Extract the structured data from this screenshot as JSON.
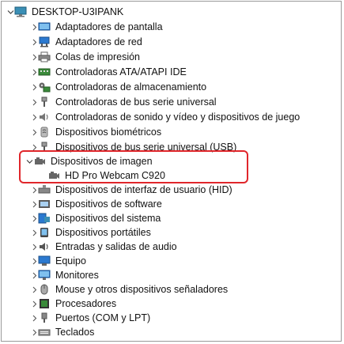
{
  "root": {
    "label": "DESKTOP-U3IPANK"
  },
  "categories": [
    {
      "label": "Adaptadores de pantalla",
      "icon": "display-adapter-icon"
    },
    {
      "label": "Adaptadores de red",
      "icon": "network-adapter-icon"
    },
    {
      "label": "Colas de impresión",
      "icon": "print-queue-icon"
    },
    {
      "label": "Controladoras ATA/ATAPI IDE",
      "icon": "ide-controller-icon"
    },
    {
      "label": "Controladoras de almacenamiento",
      "icon": "storage-controller-icon"
    },
    {
      "label": "Controladoras de bus serie universal",
      "icon": "usb-controller-icon"
    },
    {
      "label": "Controladoras de sonido y vídeo y dispositivos de juego",
      "icon": "sound-icon"
    },
    {
      "label": "Dispositivos biométricos",
      "icon": "biometric-icon"
    },
    {
      "label": "Dispositivos de bus serie universal (USB)",
      "icon": "usb-device-icon"
    },
    {
      "label": "Dispositivos de imagen",
      "icon": "camera-icon",
      "expanded": true,
      "children": [
        {
          "label": "HD Pro Webcam C920",
          "icon": "webcam-icon"
        }
      ]
    },
    {
      "label": "Dispositivos de interfaz de usuario (HID)",
      "icon": "hid-icon"
    },
    {
      "label": "Dispositivos de software",
      "icon": "software-device-icon"
    },
    {
      "label": "Dispositivos del sistema",
      "icon": "system-device-icon"
    },
    {
      "label": "Dispositivos portátiles",
      "icon": "portable-device-icon"
    },
    {
      "label": "Entradas y salidas de audio",
      "icon": "audio-io-icon"
    },
    {
      "label": "Equipo",
      "icon": "computer-icon"
    },
    {
      "label": "Monitores",
      "icon": "monitor-icon"
    },
    {
      "label": "Mouse y otros dispositivos señaladores",
      "icon": "mouse-icon"
    },
    {
      "label": "Procesadores",
      "icon": "processor-icon"
    },
    {
      "label": "Puertos (COM y LPT)",
      "icon": "port-icon"
    },
    {
      "label": "Teclados",
      "icon": "keyboard-icon"
    }
  ],
  "colors": {
    "highlight": "#e0262b",
    "accent_blue": "#2b79d0",
    "accent_teal": "#3a8fb5"
  }
}
